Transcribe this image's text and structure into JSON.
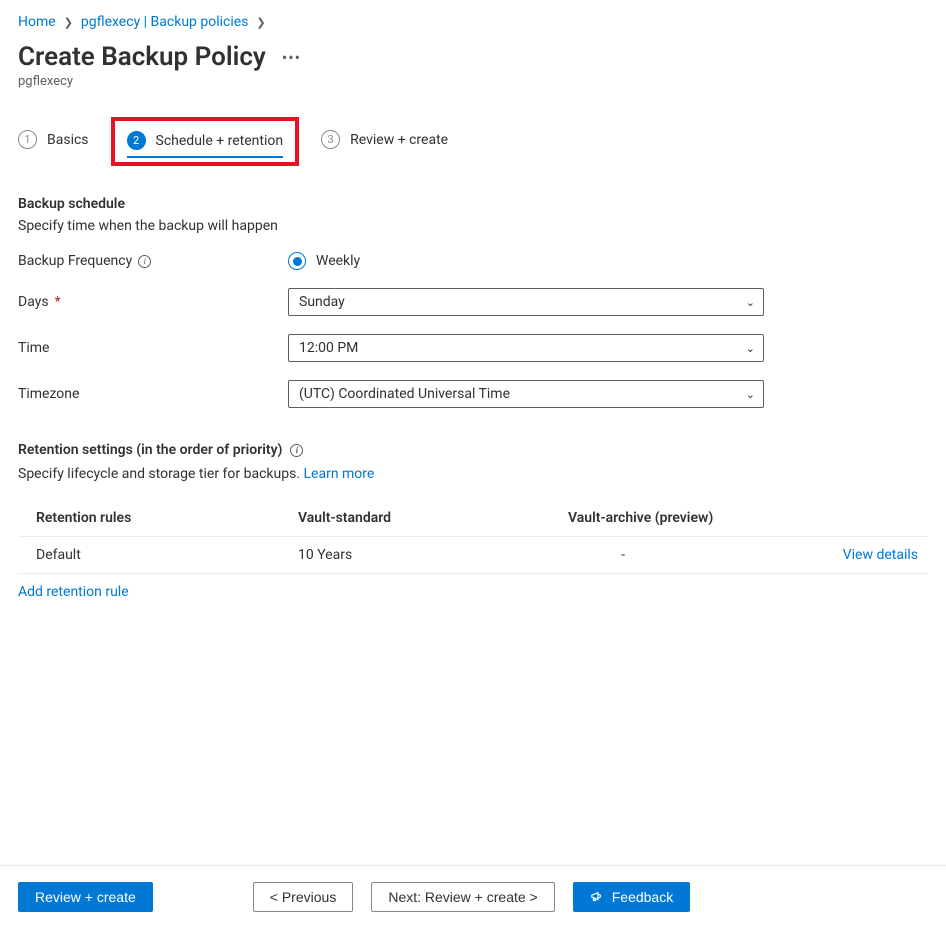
{
  "breadcrumb": {
    "items": [
      "Home",
      "pgflexecy | Backup policies"
    ]
  },
  "header": {
    "title": "Create Backup Policy",
    "subtitle": "pgflexecy"
  },
  "steps": {
    "items": [
      {
        "num": "1",
        "label": "Basics"
      },
      {
        "num": "2",
        "label": "Schedule + retention"
      },
      {
        "num": "3",
        "label": "Review + create"
      }
    ],
    "active_index": 1
  },
  "schedule": {
    "heading": "Backup schedule",
    "desc": "Specify time when the backup will happen",
    "frequency_label": "Backup Frequency",
    "frequency_value": "Weekly",
    "days_label": "Days",
    "days_value": "Sunday",
    "time_label": "Time",
    "time_value": "12:00 PM",
    "timezone_label": "Timezone",
    "timezone_value": "(UTC) Coordinated Universal Time"
  },
  "retention": {
    "heading": "Retention settings (in the order of priority)",
    "desc_prefix": "Specify lifecycle and storage tier for backups. ",
    "learn_more": "Learn more",
    "columns": {
      "rules": "Retention rules",
      "vault_standard": "Vault-standard",
      "vault_archive": "Vault-archive (preview)"
    },
    "rows": [
      {
        "name": "Default",
        "vault_standard": "10 Years",
        "vault_archive": "-",
        "action": "View details"
      }
    ],
    "add_rule": "Add retention rule"
  },
  "footer": {
    "review": "Review + create",
    "previous": "<  Previous",
    "next": "Next: Review + create  >",
    "feedback": "Feedback"
  }
}
